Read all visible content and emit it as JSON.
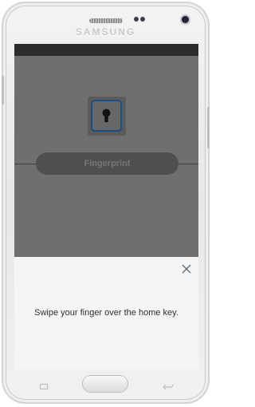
{
  "device": {
    "brand": "SAMSUNG"
  },
  "screen": {
    "fingerprint_button_label": "Fingerprint",
    "sheet": {
      "instruction": "Swipe your finger over the home key."
    }
  },
  "icons": {
    "fingerprint": "keyhole-icon",
    "close": "close-icon",
    "recent_apps": "recent-apps-icon",
    "back": "back-icon"
  },
  "colors": {
    "accent": "#1b4f84",
    "dim_overlay": "#6f6f6f",
    "sheet": "#f5f5f5"
  }
}
